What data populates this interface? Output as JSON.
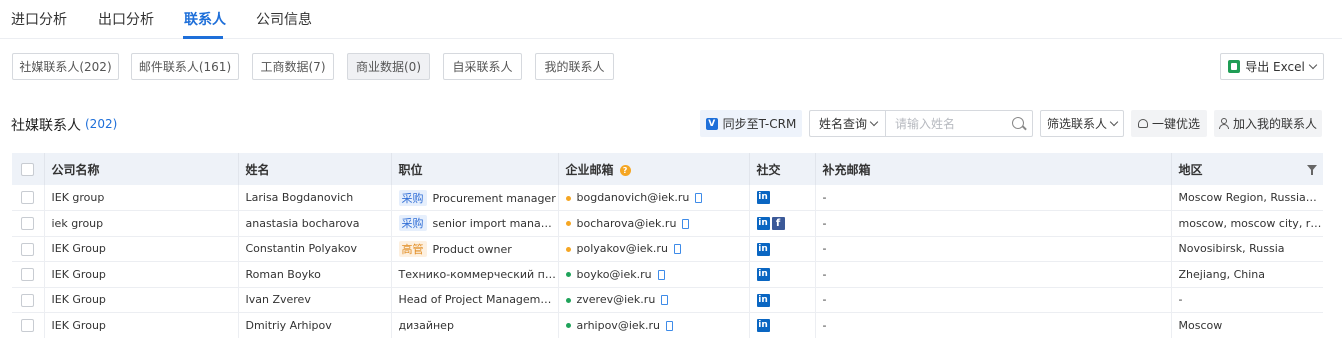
{
  "tabs": [
    {
      "label": "进口分析"
    },
    {
      "label": "出口分析"
    },
    {
      "label": "联系人"
    },
    {
      "label": "公司信息"
    }
  ],
  "filters": [
    {
      "label": "社媒联系人(202)"
    },
    {
      "label": "邮件联系人(161)"
    },
    {
      "label": "工商数据(7)"
    },
    {
      "label": "商业数据(0)"
    },
    {
      "label": "自采联系人"
    },
    {
      "label": "我的联系人"
    }
  ],
  "export": {
    "label": "导出 Excel",
    "icon": "excel-icon"
  },
  "section": {
    "title": "社媒联系人",
    "count": "(202)"
  },
  "toolbar": {
    "sync_label": "同步至T-CRM",
    "name_query_label": "姓名查询",
    "name_placeholder": "请输入姓名",
    "filter_contacts_label": "筛选联系人",
    "one_click_label": "一键优选",
    "add_mine_label": "加入我的联系人"
  },
  "table": {
    "headers": {
      "company": "公司名称",
      "name": "姓名",
      "position": "职位",
      "email": "企业邮箱",
      "social": "社交",
      "extra_email": "补充邮箱",
      "region": "地区"
    },
    "rows": [
      {
        "company": "IEK group",
        "name": "Larisa Bogdanovich",
        "tag": "采购",
        "position": "Procurement manager",
        "email": "bogdanovich@iek.ru",
        "extra": "-",
        "region": "Moscow Region, Russian Fe..."
      },
      {
        "company": "iek group",
        "name": "anastasia bocharova",
        "tag": "采购",
        "position": "senior import manager",
        "email": "bocharova@iek.ru",
        "extra": "-",
        "region": "moscow, moscow city, russia"
      },
      {
        "company": "IEK Group",
        "name": "Constantin Polyakov",
        "tag": "高管",
        "position": "Product owner",
        "email": "polyakov@iek.ru",
        "extra": "-",
        "region": "Novosibirsk, Russia"
      },
      {
        "company": "IEK Group",
        "name": "Roman Boyko",
        "tag": "",
        "position": "Технико-коммерческий пре...",
        "email": "boyko@iek.ru",
        "extra": "-",
        "region": "Zhejiang, China"
      },
      {
        "company": "IEK Group",
        "name": "Ivan Zverev",
        "tag": "",
        "position": "Head of Project Management ...",
        "email": "zverev@iek.ru",
        "extra": "-",
        "region": "-"
      },
      {
        "company": "IEK Group",
        "name": "Dmitriy Arhipov",
        "tag": "",
        "position": "дизайнер",
        "email": "arhipov@iek.ru",
        "extra": "-",
        "region": "Moscow"
      }
    ]
  },
  "colors": {
    "accent": "#1e6fd9",
    "dot_orange": "#f5a623",
    "dot_green": "#1fa35a",
    "linkedin": "#0a66c2",
    "facebook": "#3b5998"
  }
}
